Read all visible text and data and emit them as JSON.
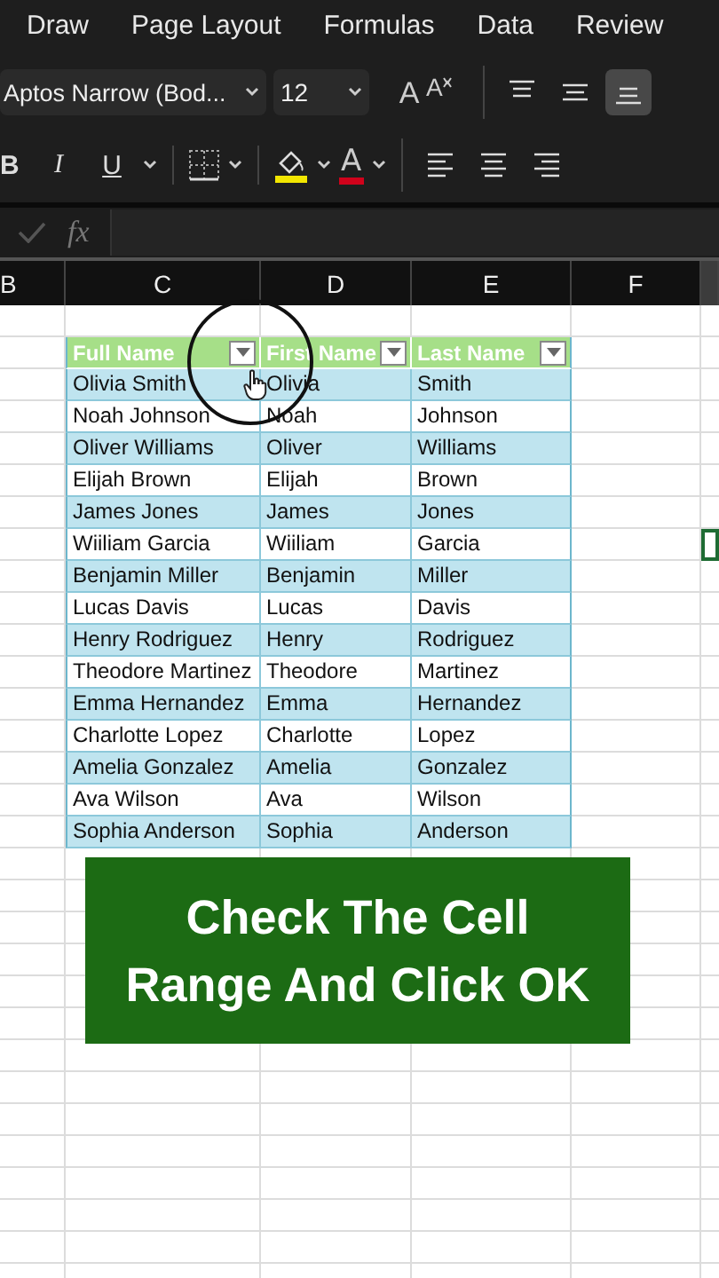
{
  "ribbon_tabs": [
    {
      "label": "Draw"
    },
    {
      "label": "Page Layout"
    },
    {
      "label": "Formulas"
    },
    {
      "label": "Data"
    },
    {
      "label": "Review"
    }
  ],
  "font": {
    "name": "Aptos Narrow (Bod...",
    "size": "12"
  },
  "font_size_buttons": [
    {
      "kind": "grow",
      "label": "A"
    },
    {
      "kind": "shrink",
      "label": "A"
    }
  ],
  "vertical_align": [
    {
      "kind": "top",
      "selected": false
    },
    {
      "kind": "middle",
      "selected": false
    },
    {
      "kind": "bottom",
      "selected": true
    }
  ],
  "style_buttons": [
    {
      "kind": "bold",
      "label": "B"
    },
    {
      "kind": "italic",
      "label": "I"
    },
    {
      "kind": "underline",
      "label": "U"
    }
  ],
  "font_color": {
    "label": "A"
  },
  "horizontal_align": [
    {
      "kind": "left"
    },
    {
      "kind": "center"
    },
    {
      "kind": "right"
    }
  ],
  "formula_bar": {
    "function_label": "fx"
  },
  "column_headers": [
    "B",
    "C",
    "D",
    "E",
    "F"
  ],
  "table": {
    "columns": [
      {
        "label": "Full Name"
      },
      {
        "label": "First Name"
      },
      {
        "label": "Last Name"
      }
    ],
    "rows": [
      [
        "Olivia Smith",
        "Olivia",
        "Smith"
      ],
      [
        "Noah Johnson",
        "Noah",
        "Johnson"
      ],
      [
        "Oliver Williams",
        "Oliver",
        "Williams"
      ],
      [
        "Elijah Brown",
        "Elijah",
        "Brown"
      ],
      [
        "James Jones",
        "James",
        "Jones"
      ],
      [
        "Wiiliam Garcia",
        "Wiiliam",
        "Garcia"
      ],
      [
        "Benjamin Miller",
        "Benjamin",
        "Miller"
      ],
      [
        "Lucas Davis",
        "Lucas",
        "Davis"
      ],
      [
        "Henry Rodriguez",
        "Henry",
        "Rodriguez"
      ],
      [
        "Theodore Martinez",
        "Theodore",
        "Martinez"
      ],
      [
        "Emma Hernandez",
        "Emma",
        "Hernandez"
      ],
      [
        "Charlotte Lopez",
        "Charlotte",
        "Lopez"
      ],
      [
        "Amelia Gonzalez",
        "Amelia",
        "Gonzalez"
      ],
      [
        "Ava Wilson",
        "Ava",
        "Wilson"
      ],
      [
        "Sophia Anderson",
        "Sophia",
        "Anderson"
      ]
    ]
  },
  "caption": {
    "lines": [
      "Check The Cell",
      "Range And Click OK"
    ]
  }
}
